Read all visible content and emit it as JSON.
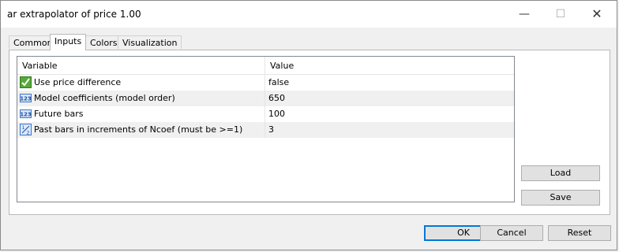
{
  "window": {
    "title": "ar extrapolator of price 1.00"
  },
  "window_controls": {
    "minimize": "—",
    "maximize": "☐",
    "close": "✕"
  },
  "tabs": [
    {
      "label": "Common",
      "active": false
    },
    {
      "label": "Inputs",
      "active": true
    },
    {
      "label": "Colors",
      "active": false
    },
    {
      "label": "Visualization",
      "active": false
    }
  ],
  "grid": {
    "columns": [
      "Variable",
      "Value"
    ],
    "rows": [
      {
        "icon": "bool-type-icon",
        "name": "Use price difference",
        "value": "false"
      },
      {
        "icon": "int-type-icon",
        "name": "Model coefficients (model order)",
        "value": "650"
      },
      {
        "icon": "int-type-icon",
        "name": "Future bars",
        "value": "100"
      },
      {
        "icon": "fraction-type-icon",
        "name": "Past bars in increments of Ncoef (must be >=1)",
        "value": "3"
      }
    ]
  },
  "side_buttons": {
    "load": "Load",
    "save": "Save"
  },
  "footer": {
    "ok": "OK",
    "cancel": "Cancel",
    "reset": "Reset"
  },
  "colors": {
    "accent": "#0078d7",
    "row_alt": "#f0f0f0"
  }
}
